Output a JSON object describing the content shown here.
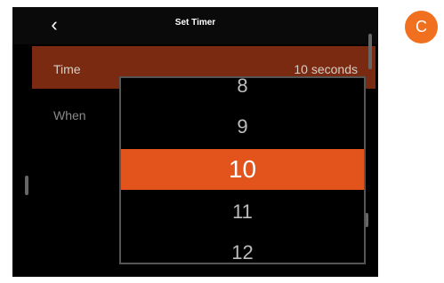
{
  "header": {
    "back_icon": "chevron-left-icon",
    "title": "Set Timer"
  },
  "settings": {
    "time": {
      "label": "Time",
      "value": "10 seconds"
    },
    "when": {
      "label": "When"
    }
  },
  "picker": {
    "options": [
      "8",
      "9",
      "10",
      "11",
      "12"
    ],
    "selected": "10"
  },
  "badge": {
    "letter": "C"
  },
  "colors": {
    "accent": "#e3541c",
    "row_highlight": "#7a2a10",
    "badge": "#f07020"
  }
}
